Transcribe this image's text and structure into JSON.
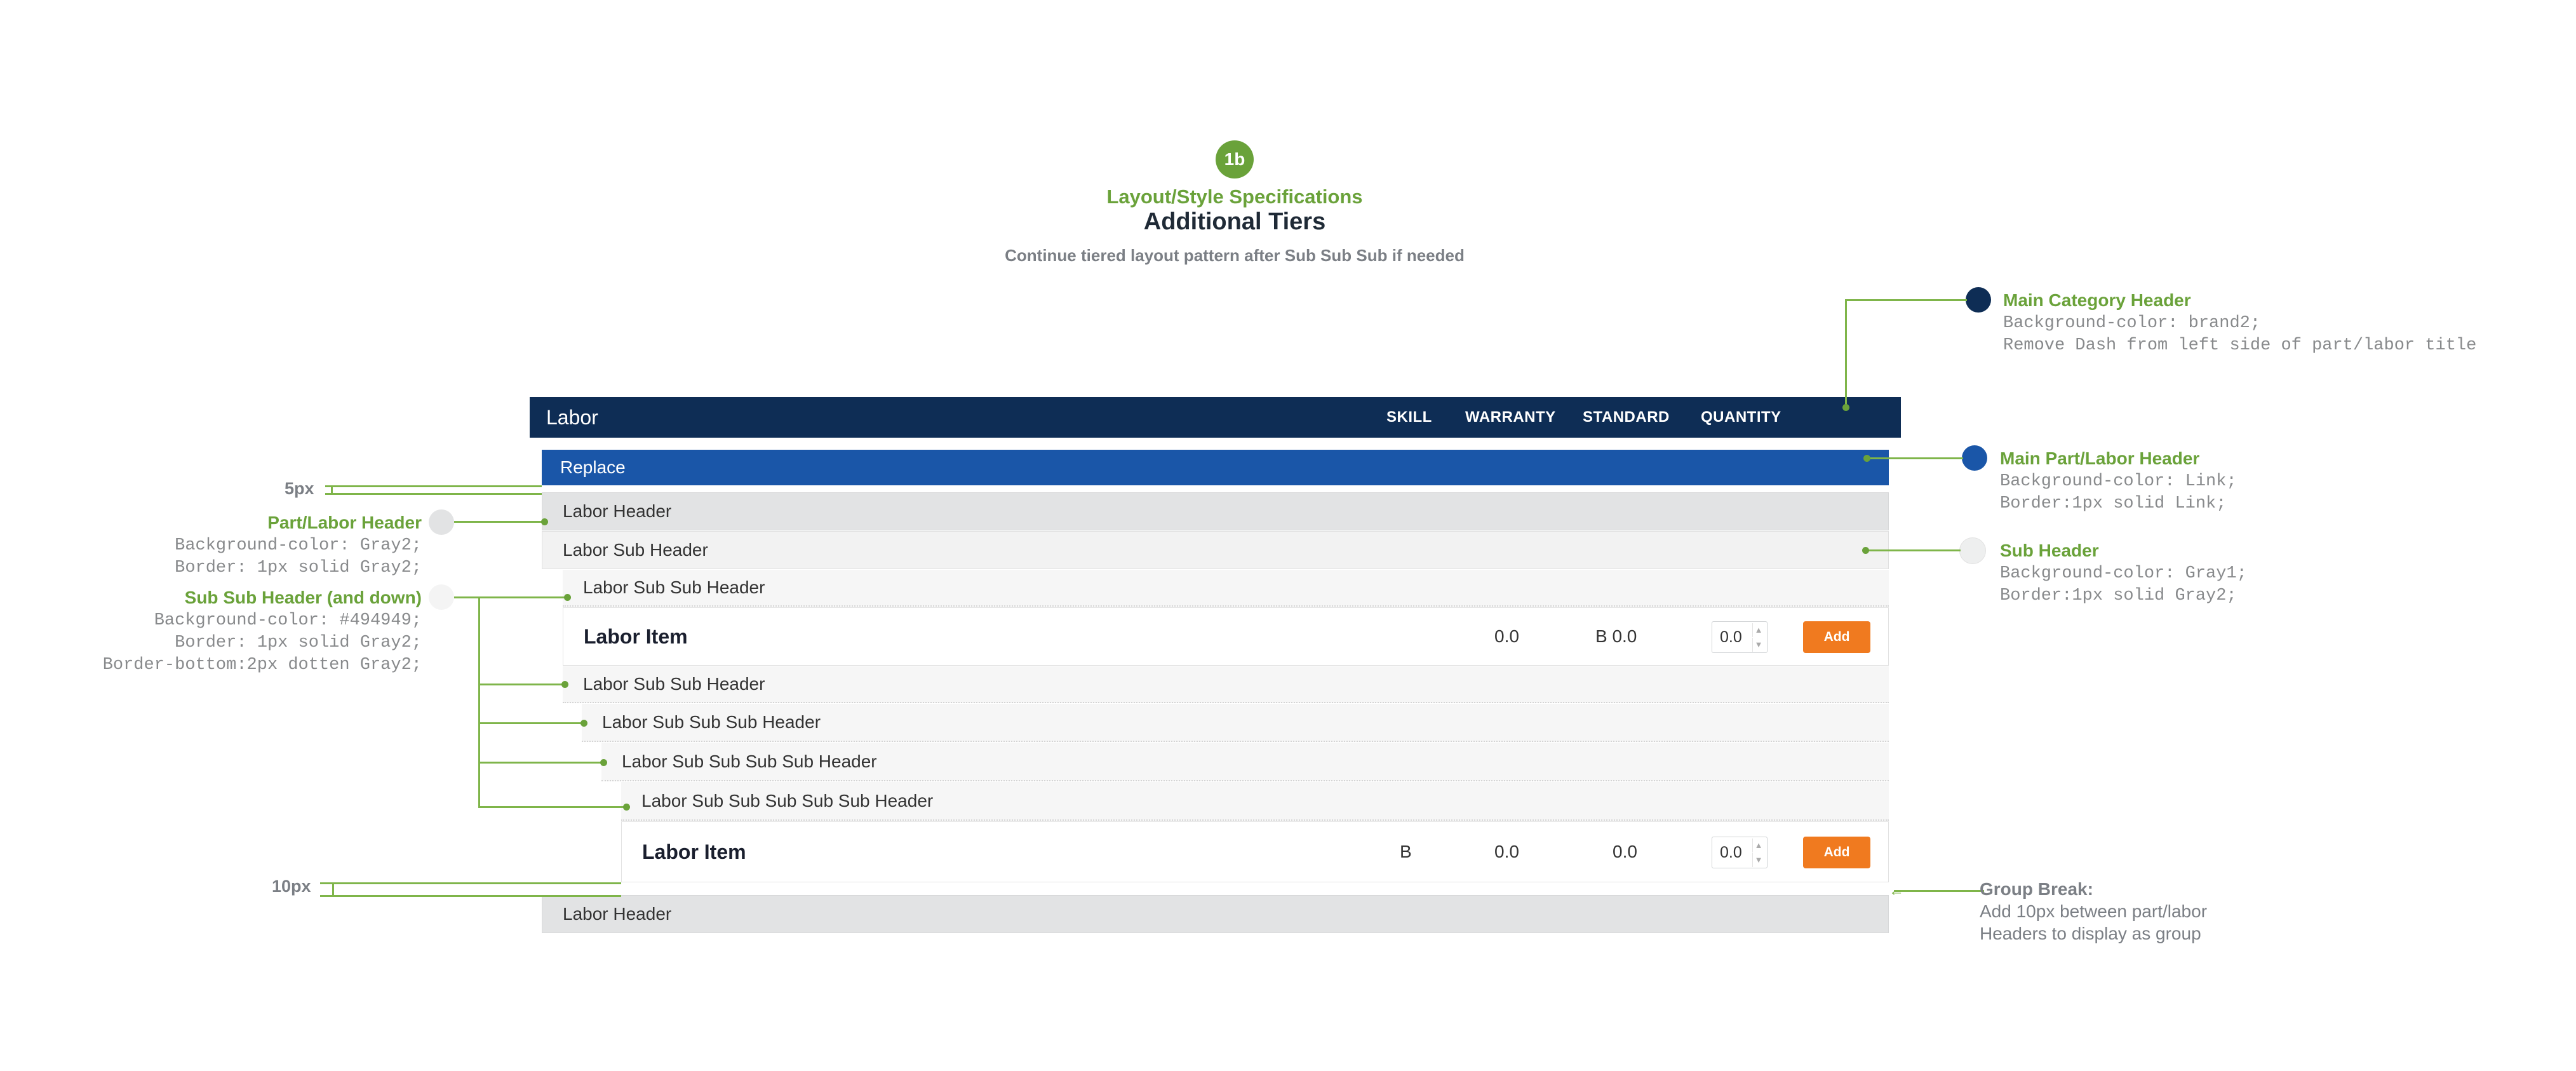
{
  "header": {
    "badge": "1b",
    "spec_title": "Layout/Style Specifications",
    "main_title": "Additional Tiers",
    "subtitle": "Continue tiered layout pattern after Sub Sub Sub if needed"
  },
  "table": {
    "main_header": "Labor",
    "columns": [
      "SKILL",
      "WARRANTY",
      "STANDARD",
      "QUANTITY"
    ],
    "replace_label": "Replace",
    "labor_header_1": "Labor Header",
    "labor_sub_header": "Labor Sub Header",
    "sub_sub_1": "Labor Sub Sub Header",
    "item1": {
      "name": "Labor Item",
      "warranty": "0.0",
      "standard": "B 0.0",
      "qty": "0.0",
      "button": "Add"
    },
    "sub_sub_2": "Labor Sub Sub Header",
    "sub_sub_sub": "Labor Sub Sub Sub Header",
    "sub_sub_sub_sub": "Labor Sub Sub Sub Sub Header",
    "sub_sub_sub_sub_sub": "Labor Sub Sub Sub Sub Sub Header",
    "item2": {
      "name": "Labor Item",
      "skill": "B",
      "warranty": "0.0",
      "standard": "0.0",
      "qty": "0.0",
      "button": "Add"
    },
    "labor_header_2": "Labor Header"
  },
  "annotations": {
    "main_category": {
      "title": "Main Category Header",
      "lines": [
        "Background-color: brand2;",
        "Remove Dash from left side of part/labor title"
      ]
    },
    "main_part": {
      "title": "Main Part/Labor Header",
      "lines": [
        "Background-color: Link;",
        "Border:1px solid Link;"
      ]
    },
    "sub_header": {
      "title": "Sub Header",
      "lines": [
        "Background-color: Gray1;",
        "Border:1px solid Gray2;"
      ]
    },
    "part_labor_header": {
      "title": "Part/Labor Header",
      "lines": [
        "Background-color: Gray2;",
        "Border: 1px solid Gray2;"
      ]
    },
    "sub_sub_header": {
      "title": "Sub Sub Header (and down)",
      "lines": [
        "Background-color: #494949;",
        "Border: 1px solid Gray2;",
        "Border-bottom:2px dotten Gray2;"
      ]
    },
    "spacing_5": "5px",
    "spacing_10": "10px",
    "group_break": {
      "title": "Group Break:",
      "lines": [
        "Add 10px between part/labor",
        "Headers to display as group"
      ]
    }
  },
  "colors": {
    "brand2": "#0e2d55",
    "link": "#1a56a8",
    "accent_green": "#6aa23a",
    "add_button": "#f07a1f",
    "gray1": "#f2f2f2",
    "gray2": "#e2e3e4"
  }
}
